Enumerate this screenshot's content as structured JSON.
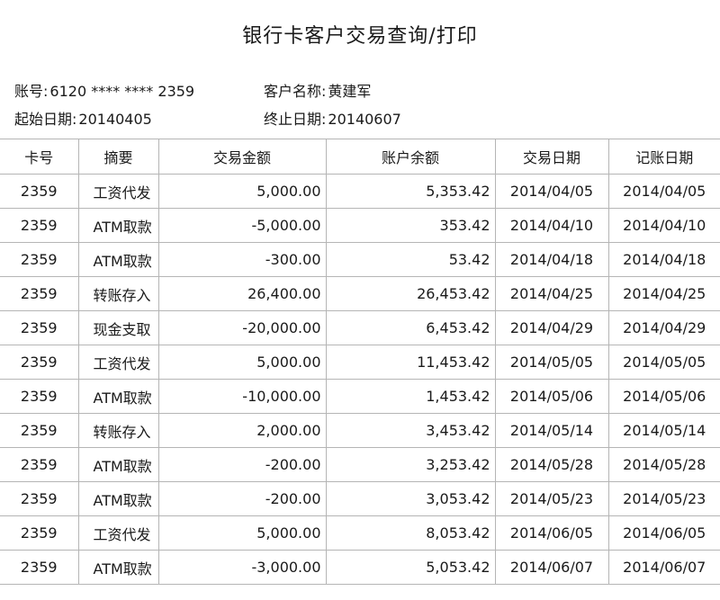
{
  "page": {
    "title": "银行卡客户交易查询/打印"
  },
  "info": {
    "account_label": "账号:",
    "account_value": "6120 **** **** 2359",
    "customer_label": "客户名称:",
    "customer_value": "黄建军",
    "start_label": "起始日期:",
    "start_value": "20140405",
    "end_label": "终止日期:",
    "end_value": "20140607"
  },
  "table": {
    "headers": [
      "卡号",
      "摘要",
      "交易金额",
      "账户余额",
      "交易日期",
      "记账日期"
    ],
    "rows": [
      [
        "2359",
        "工资代发",
        "5,000.00",
        "5,353.42",
        "2014/04/05",
        "2014/04/05"
      ],
      [
        "2359",
        "ATM取款",
        "-5,000.00",
        "353.42",
        "2014/04/10",
        "2014/04/10"
      ],
      [
        "2359",
        "ATM取款",
        "-300.00",
        "53.42",
        "2014/04/18",
        "2014/04/18"
      ],
      [
        "2359",
        "转账存入",
        "26,400.00",
        "26,453.42",
        "2014/04/25",
        "2014/04/25"
      ],
      [
        "2359",
        "现金支取",
        "-20,000.00",
        "6,453.42",
        "2014/04/29",
        "2014/04/29"
      ],
      [
        "2359",
        "工资代发",
        "5,000.00",
        "11,453.42",
        "2014/05/05",
        "2014/05/05"
      ],
      [
        "2359",
        "ATM取款",
        "-10,000.00",
        "1,453.42",
        "2014/05/06",
        "2014/05/06"
      ],
      [
        "2359",
        "转账存入",
        "2,000.00",
        "3,453.42",
        "2014/05/14",
        "2014/05/14"
      ],
      [
        "2359",
        "ATM取款",
        "-200.00",
        "3,253.42",
        "2014/05/28",
        "2014/05/28"
      ],
      [
        "2359",
        "ATM取款",
        "-200.00",
        "3,053.42",
        "2014/05/23",
        "2014/05/23"
      ],
      [
        "2359",
        "工资代发",
        "5,000.00",
        "8,053.42",
        "2014/06/05",
        "2014/06/05"
      ],
      [
        "2359",
        "ATM取款",
        "-3,000.00",
        "5,053.42",
        "2014/06/07",
        "2014/06/07"
      ]
    ]
  }
}
